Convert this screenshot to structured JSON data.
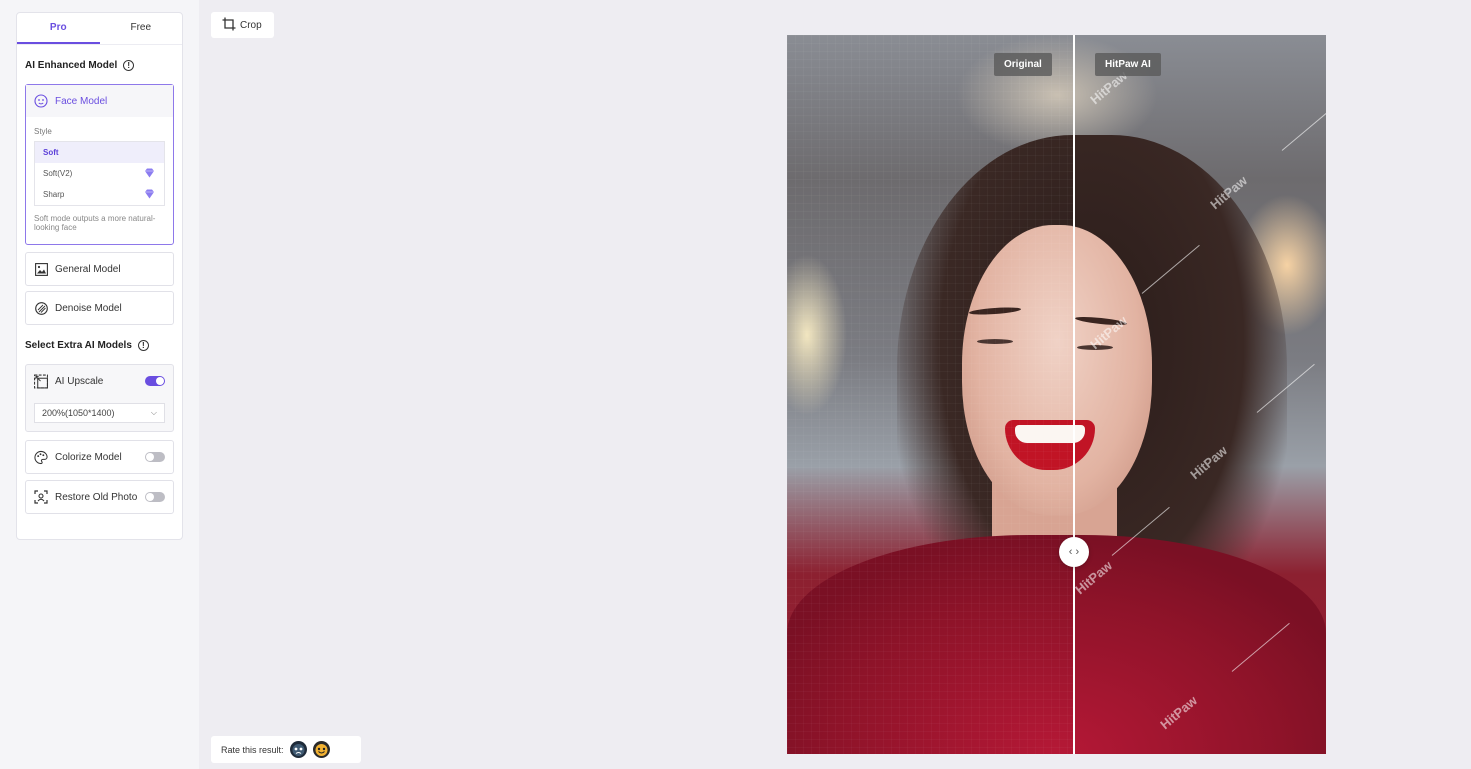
{
  "tabs": [
    {
      "label": "Pro",
      "active": true
    },
    {
      "label": "Free",
      "active": false
    }
  ],
  "ai_enhanced": {
    "title": "AI Enhanced Model",
    "face_model": {
      "label": "Face Model",
      "style_label": "Style",
      "styles": [
        {
          "label": "Soft",
          "selected": true,
          "premium": false
        },
        {
          "label": "Soft(V2)",
          "selected": false,
          "premium": true
        },
        {
          "label": "Sharp",
          "selected": false,
          "premium": true
        }
      ],
      "description": "Soft mode outputs a more natural-looking face"
    },
    "general_model": "General Model",
    "denoise_model": "Denoise Model"
  },
  "extra": {
    "title": "Select Extra AI Models",
    "upscale": {
      "label": "AI Upscale",
      "enabled": true,
      "option": "200%(1050*1400)"
    },
    "colorize": {
      "label": "Colorize Model",
      "enabled": false
    },
    "restore": {
      "label": "Restore Old Photo",
      "enabled": false
    }
  },
  "toolbar": {
    "crop_label": "Crop"
  },
  "compare": {
    "left_label": "Original",
    "right_label": "HitPaw AI",
    "watermark": "HitPaw"
  },
  "rating": {
    "label": "Rate this result:"
  },
  "colors": {
    "accent": "#6a4ee0",
    "background": "#eeedf2"
  }
}
